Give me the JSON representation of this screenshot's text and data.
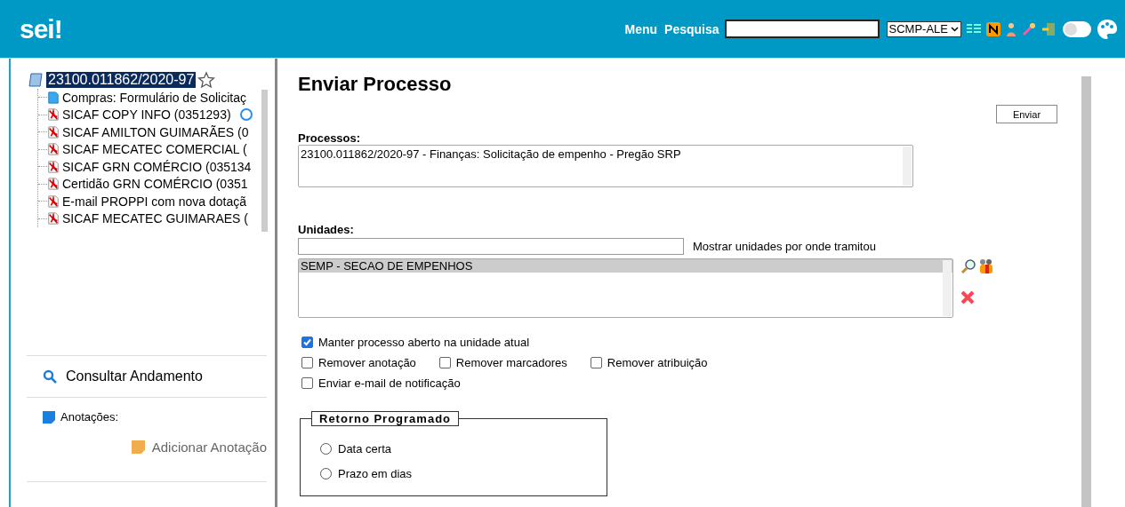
{
  "header": {
    "logo": "sei!",
    "links": [
      "Menu",
      "Pesquisa"
    ],
    "unit_select": "SCMP-ALE",
    "theme_toggle": {
      "on": false
    }
  },
  "tree": {
    "root": {
      "label": "23100.011862/2020-97",
      "selected": true
    },
    "children": [
      {
        "kind": "doc",
        "label": "Compras: Formulário de Solicitaç",
        "marked": false
      },
      {
        "kind": "pdf",
        "label": "SICAF COPY INFO (0351293)",
        "marked": true
      },
      {
        "kind": "pdf",
        "label": "SICAF AMILTON GUIMARÃES (0",
        "marked": false
      },
      {
        "kind": "pdf",
        "label": "SICAF MECATEC COMERCIAL (",
        "marked": false
      },
      {
        "kind": "pdf",
        "label": "SICAF GRN COMÉRCIO (035134",
        "marked": false
      },
      {
        "kind": "pdf",
        "label": "Certidão GRN COMÉRCIO (0351",
        "marked": false
      },
      {
        "kind": "pdf",
        "label": "E-mail PROPPI com nova dotaçã",
        "marked": false
      },
      {
        "kind": "pdf",
        "label": "SICAF MECATEC GUIMARAES (",
        "marked": false
      }
    ]
  },
  "sidebar": {
    "consultar": "Consultar Andamento",
    "anotacoes": "Anotações:",
    "adicionar": "Adicionar Anotação"
  },
  "main": {
    "title": "Enviar Processo",
    "send_button": "Enviar",
    "processos": {
      "label": "Processos:",
      "value": "23100.011862/2020-97 - Finanças: Solicitação de empenho - Pregão SRP"
    },
    "unidades": {
      "label": "Unidades:",
      "hint": "Mostrar unidades por onde tramitou",
      "items": [
        {
          "label": "SEMP - SECAO DE EMPENHOS",
          "selected": true
        }
      ]
    },
    "options": [
      [
        {
          "label": "Manter processo aberto na unidade atual",
          "checked": true
        }
      ],
      [
        {
          "label": "Remover anotação",
          "checked": false
        },
        {
          "label": "Remover marcadores",
          "checked": false
        },
        {
          "label": "Remover atribuição",
          "checked": false
        }
      ],
      [
        {
          "label": "Enviar e-mail de notificação",
          "checked": false
        }
      ]
    ],
    "retorno": {
      "legend": "Retorno Programado",
      "radios": [
        {
          "label": "Data certa",
          "selected": false
        },
        {
          "label": "Prazo em dias",
          "selected": false
        }
      ]
    }
  }
}
